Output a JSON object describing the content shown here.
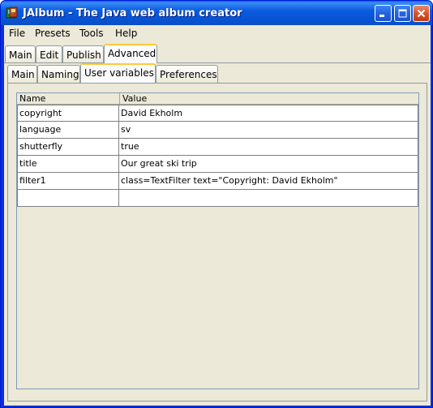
{
  "window": {
    "title": "JAlbum - The Java web album creator",
    "icon": "jalbum-app-icon"
  },
  "menu": {
    "items": [
      "File",
      "Presets",
      "Tools",
      "Help"
    ]
  },
  "top_tabs": {
    "items": [
      "Main",
      "Edit",
      "Publish",
      "Advanced"
    ],
    "active": "Advanced"
  },
  "sub_tabs": {
    "items": [
      "Main",
      "Naming",
      "User variables",
      "Preferences"
    ],
    "active": "User variables"
  },
  "table": {
    "columns": [
      "Name",
      "Value"
    ],
    "rows": [
      {
        "name": "copyright",
        "value": "David Ekholm"
      },
      {
        "name": "language",
        "value": "sv"
      },
      {
        "name": "shutterfly",
        "value": "true"
      },
      {
        "name": "title",
        "value": "Our great ski trip"
      },
      {
        "name": "filter1",
        "value": "class=TextFilter text=\"Copyright: David Ekholm\""
      },
      {
        "name": "",
        "value": ""
      }
    ]
  },
  "colors": {
    "titlebar": "#0a5ee8",
    "active_tab_highlight": "#ffc83c",
    "client_bg": "#ece9d8"
  }
}
